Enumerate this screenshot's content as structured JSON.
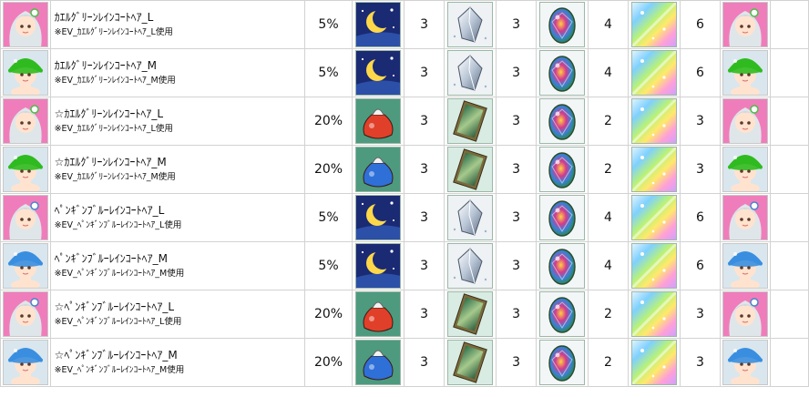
{
  "rows": [
    {
      "name": "ｶｴﾙｸﾞﾘｰﾝﾚｲﾝｺｰﾄﾍｱ_L",
      "note": "※EV_ｶｴﾙｸﾞﾘｰﾝﾚｲﾝｺｰﾄﾍｱ_L使用",
      "rate": "5%",
      "avatar": "green-hair-avatar-icon",
      "item1": "crescent-moon-icon",
      "q1": "3",
      "item2": "silver-crystal-icon",
      "q2": "3",
      "item3": "rainbow-egg-gem-icon",
      "q3": "4",
      "item4": "rainbow-sparkle-icon",
      "q4": "6"
    },
    {
      "name": "ｶｴﾙｸﾞﾘｰﾝﾚｲﾝｺｰﾄﾍｱ_M",
      "note": "※EV_ｶｴﾙｸﾞﾘｰﾝﾚｲﾝｺｰﾄﾍｱ_M使用",
      "rate": "5%",
      "avatar": "green-rain-hat-avatar-icon",
      "item1": "crescent-moon-icon",
      "q1": "3",
      "item2": "silver-crystal-icon",
      "q2": "3",
      "item3": "rainbow-egg-gem-icon",
      "q3": "4",
      "item4": "rainbow-sparkle-icon",
      "q4": "6"
    },
    {
      "name": "☆ｶｴﾙｸﾞﾘｰﾝﾚｲﾝｺｰﾄﾍｱ_L",
      "note": "※EV_ｶｴﾙｸﾞﾘｰﾝﾚｲﾝｺｰﾄﾍｱ_L使用",
      "rate": "20%",
      "avatar": "green-hair-avatar-icon",
      "item1": "red-pouch-icon",
      "q1": "3",
      "item2": "framed-card-icon",
      "q2": "3",
      "item3": "rainbow-egg-gem-icon",
      "q3": "2",
      "item4": "rainbow-sparkle-icon",
      "q4": "3"
    },
    {
      "name": "☆ｶｴﾙｸﾞﾘｰﾝﾚｲﾝｺｰﾄﾍｱ_M",
      "note": "※EV_ｶｴﾙｸﾞﾘｰﾝﾚｲﾝｺｰﾄﾍｱ_M使用",
      "rate": "20%",
      "avatar": "green-rain-hat-avatar-icon",
      "item1": "blue-pouch-icon",
      "q1": "3",
      "item2": "framed-card-icon",
      "q2": "3",
      "item3": "rainbow-egg-gem-icon",
      "q3": "2",
      "item4": "rainbow-sparkle-icon",
      "q4": "3"
    },
    {
      "name": "ﾍﾟﾝｷﾞﾝﾌﾞﾙｰﾚｲﾝｺｰﾄﾍｱ_L",
      "note": "※EV_ﾍﾟﾝｷﾞﾝﾌﾞﾙｰﾚｲﾝｺｰﾄﾍｱ_L使用",
      "rate": "5%",
      "avatar": "blue-hair-avatar-icon",
      "item1": "crescent-moon-icon",
      "q1": "3",
      "item2": "silver-crystal-icon",
      "q2": "3",
      "item3": "rainbow-egg-gem-icon",
      "q3": "4",
      "item4": "rainbow-sparkle-icon",
      "q4": "6"
    },
    {
      "name": "ﾍﾟﾝｷﾞﾝﾌﾞﾙｰﾚｲﾝｺｰﾄﾍｱ_M",
      "note": "※EV_ﾍﾟﾝｷﾞﾝﾌﾞﾙｰﾚｲﾝｺｰﾄﾍｱ_M使用",
      "rate": "5%",
      "avatar": "blue-rain-hat-avatar-icon",
      "item1": "crescent-moon-icon",
      "q1": "3",
      "item2": "silver-crystal-icon",
      "q2": "3",
      "item3": "rainbow-egg-gem-icon",
      "q3": "4",
      "item4": "rainbow-sparkle-icon",
      "q4": "6"
    },
    {
      "name": "☆ﾍﾟﾝｷﾞﾝﾌﾞﾙｰﾚｲﾝｺｰﾄﾍｱ_L",
      "note": "※EV_ﾍﾟﾝｷﾞﾝﾌﾞﾙｰﾚｲﾝｺｰﾄﾍｱ_L使用",
      "rate": "20%",
      "avatar": "blue-hair-avatar-icon",
      "item1": "red-pouch-icon",
      "q1": "3",
      "item2": "framed-card-icon",
      "q2": "3",
      "item3": "rainbow-egg-gem-icon",
      "q3": "2",
      "item4": "rainbow-sparkle-icon",
      "q4": "3"
    },
    {
      "name": "☆ﾍﾟﾝｷﾞﾝﾌﾞﾙｰﾚｲﾝｺｰﾄﾍｱ_M",
      "note": "※EV_ﾍﾟﾝｷﾞﾝﾌﾞﾙｰﾚｲﾝｺｰﾄﾍｱ_M使用",
      "rate": "20%",
      "avatar": "blue-rain-hat-avatar-icon",
      "item1": "blue-pouch-icon",
      "q1": "3",
      "item2": "framed-card-icon",
      "q2": "3",
      "item3": "rainbow-egg-gem-icon",
      "q3": "2",
      "item4": "rainbow-sparkle-icon",
      "q4": "3"
    }
  ],
  "colors": {
    "hair_bg": "#f07dbb",
    "hat_bg": "#d9e6ee",
    "green_hat": "#2fbb1f",
    "blue_hat": "#3a8ee0",
    "moon_bg": "#1a2a73",
    "pouch_bg": "#4d9a7f",
    "card_bg": "#d8ece4",
    "grid": "#d2d2d2"
  }
}
